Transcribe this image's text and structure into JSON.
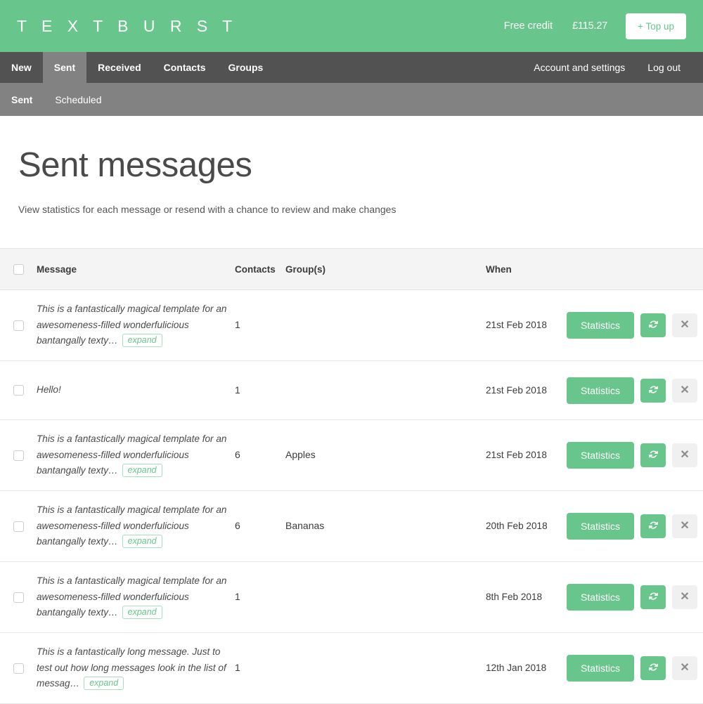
{
  "brand": {
    "name": "T E X T B U R S T",
    "accent": "#68c68c"
  },
  "topbar": {
    "free_credit_label": "Free credit",
    "credit_amount": "£115.27",
    "topup_label": "+ Top up"
  },
  "mainnav": {
    "items": [
      {
        "label": "New",
        "active": false
      },
      {
        "label": "Sent",
        "active": true
      },
      {
        "label": "Received",
        "active": false
      },
      {
        "label": "Contacts",
        "active": false
      },
      {
        "label": "Groups",
        "active": false
      }
    ],
    "right_items": [
      {
        "label": "Account and settings"
      },
      {
        "label": "Log out"
      }
    ]
  },
  "subnav": {
    "items": [
      {
        "label": "Sent",
        "active": true
      },
      {
        "label": "Scheduled",
        "active": false
      }
    ]
  },
  "page": {
    "title": "Sent messages",
    "subtitle": "View statistics for each message or resend with a chance to review and make changes"
  },
  "table": {
    "columns": {
      "message": "Message",
      "contacts": "Contacts",
      "groups": "Group(s)",
      "when": "When"
    },
    "expand_label": "expand",
    "statistics_label": "Statistics",
    "resend_icon": "refresh-icon",
    "delete_icon": "close-icon",
    "rows": [
      {
        "message": "This is a fantastically magical template for an awesomeness-filled wonderfulicious bantangally texty…",
        "has_expand": true,
        "contacts": "1",
        "group": "",
        "when": "21st Feb 2018"
      },
      {
        "message": "Hello!",
        "has_expand": false,
        "contacts": "1",
        "group": "",
        "when": "21st Feb 2018"
      },
      {
        "message": "This is a fantastically magical template for an awesomeness-filled wonderfulicious bantangally texty…",
        "has_expand": true,
        "contacts": "6",
        "group": "Apples",
        "when": "21st Feb 2018"
      },
      {
        "message": "This is a fantastically magical template for an awesomeness-filled wonderfulicious bantangally texty…",
        "has_expand": true,
        "contacts": "6",
        "group": "Bananas",
        "when": "20th Feb 2018"
      },
      {
        "message": "This is a fantastically magical template for an awesomeness-filled wonderfulicious bantangally texty…",
        "has_expand": true,
        "contacts": "1",
        "group": "",
        "when": "8th Feb 2018"
      },
      {
        "message": "This is a fantastically long message. Just to test out how long messages look in the list of messag…",
        "has_expand": true,
        "contacts": "1",
        "group": "",
        "when": "12th Jan 2018"
      }
    ]
  }
}
